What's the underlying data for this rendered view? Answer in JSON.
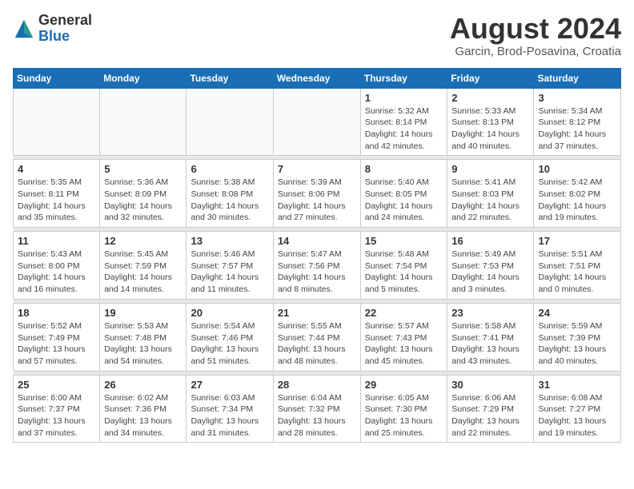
{
  "logo": {
    "general": "General",
    "blue": "Blue"
  },
  "title": "August 2024",
  "subtitle": "Garcin, Brod-Posavina, Croatia",
  "days_of_week": [
    "Sunday",
    "Monday",
    "Tuesday",
    "Wednesday",
    "Thursday",
    "Friday",
    "Saturday"
  ],
  "weeks": [
    [
      {
        "day": "",
        "info": ""
      },
      {
        "day": "",
        "info": ""
      },
      {
        "day": "",
        "info": ""
      },
      {
        "day": "",
        "info": ""
      },
      {
        "day": "1",
        "info": "Sunrise: 5:32 AM\nSunset: 8:14 PM\nDaylight: 14 hours\nand 42 minutes."
      },
      {
        "day": "2",
        "info": "Sunrise: 5:33 AM\nSunset: 8:13 PM\nDaylight: 14 hours\nand 40 minutes."
      },
      {
        "day": "3",
        "info": "Sunrise: 5:34 AM\nSunset: 8:12 PM\nDaylight: 14 hours\nand 37 minutes."
      }
    ],
    [
      {
        "day": "4",
        "info": "Sunrise: 5:35 AM\nSunset: 8:11 PM\nDaylight: 14 hours\nand 35 minutes."
      },
      {
        "day": "5",
        "info": "Sunrise: 5:36 AM\nSunset: 8:09 PM\nDaylight: 14 hours\nand 32 minutes."
      },
      {
        "day": "6",
        "info": "Sunrise: 5:38 AM\nSunset: 8:08 PM\nDaylight: 14 hours\nand 30 minutes."
      },
      {
        "day": "7",
        "info": "Sunrise: 5:39 AM\nSunset: 8:06 PM\nDaylight: 14 hours\nand 27 minutes."
      },
      {
        "day": "8",
        "info": "Sunrise: 5:40 AM\nSunset: 8:05 PM\nDaylight: 14 hours\nand 24 minutes."
      },
      {
        "day": "9",
        "info": "Sunrise: 5:41 AM\nSunset: 8:03 PM\nDaylight: 14 hours\nand 22 minutes."
      },
      {
        "day": "10",
        "info": "Sunrise: 5:42 AM\nSunset: 8:02 PM\nDaylight: 14 hours\nand 19 minutes."
      }
    ],
    [
      {
        "day": "11",
        "info": "Sunrise: 5:43 AM\nSunset: 8:00 PM\nDaylight: 14 hours\nand 16 minutes."
      },
      {
        "day": "12",
        "info": "Sunrise: 5:45 AM\nSunset: 7:59 PM\nDaylight: 14 hours\nand 14 minutes."
      },
      {
        "day": "13",
        "info": "Sunrise: 5:46 AM\nSunset: 7:57 PM\nDaylight: 14 hours\nand 11 minutes."
      },
      {
        "day": "14",
        "info": "Sunrise: 5:47 AM\nSunset: 7:56 PM\nDaylight: 14 hours\nand 8 minutes."
      },
      {
        "day": "15",
        "info": "Sunrise: 5:48 AM\nSunset: 7:54 PM\nDaylight: 14 hours\nand 5 minutes."
      },
      {
        "day": "16",
        "info": "Sunrise: 5:49 AM\nSunset: 7:53 PM\nDaylight: 14 hours\nand 3 minutes."
      },
      {
        "day": "17",
        "info": "Sunrise: 5:51 AM\nSunset: 7:51 PM\nDaylight: 14 hours\nand 0 minutes."
      }
    ],
    [
      {
        "day": "18",
        "info": "Sunrise: 5:52 AM\nSunset: 7:49 PM\nDaylight: 13 hours\nand 57 minutes."
      },
      {
        "day": "19",
        "info": "Sunrise: 5:53 AM\nSunset: 7:48 PM\nDaylight: 13 hours\nand 54 minutes."
      },
      {
        "day": "20",
        "info": "Sunrise: 5:54 AM\nSunset: 7:46 PM\nDaylight: 13 hours\nand 51 minutes."
      },
      {
        "day": "21",
        "info": "Sunrise: 5:55 AM\nSunset: 7:44 PM\nDaylight: 13 hours\nand 48 minutes."
      },
      {
        "day": "22",
        "info": "Sunrise: 5:57 AM\nSunset: 7:43 PM\nDaylight: 13 hours\nand 45 minutes."
      },
      {
        "day": "23",
        "info": "Sunrise: 5:58 AM\nSunset: 7:41 PM\nDaylight: 13 hours\nand 43 minutes."
      },
      {
        "day": "24",
        "info": "Sunrise: 5:59 AM\nSunset: 7:39 PM\nDaylight: 13 hours\nand 40 minutes."
      }
    ],
    [
      {
        "day": "25",
        "info": "Sunrise: 6:00 AM\nSunset: 7:37 PM\nDaylight: 13 hours\nand 37 minutes."
      },
      {
        "day": "26",
        "info": "Sunrise: 6:02 AM\nSunset: 7:36 PM\nDaylight: 13 hours\nand 34 minutes."
      },
      {
        "day": "27",
        "info": "Sunrise: 6:03 AM\nSunset: 7:34 PM\nDaylight: 13 hours\nand 31 minutes."
      },
      {
        "day": "28",
        "info": "Sunrise: 6:04 AM\nSunset: 7:32 PM\nDaylight: 13 hours\nand 28 minutes."
      },
      {
        "day": "29",
        "info": "Sunrise: 6:05 AM\nSunset: 7:30 PM\nDaylight: 13 hours\nand 25 minutes."
      },
      {
        "day": "30",
        "info": "Sunrise: 6:06 AM\nSunset: 7:29 PM\nDaylight: 13 hours\nand 22 minutes."
      },
      {
        "day": "31",
        "info": "Sunrise: 6:08 AM\nSunset: 7:27 PM\nDaylight: 13 hours\nand 19 minutes."
      }
    ]
  ]
}
